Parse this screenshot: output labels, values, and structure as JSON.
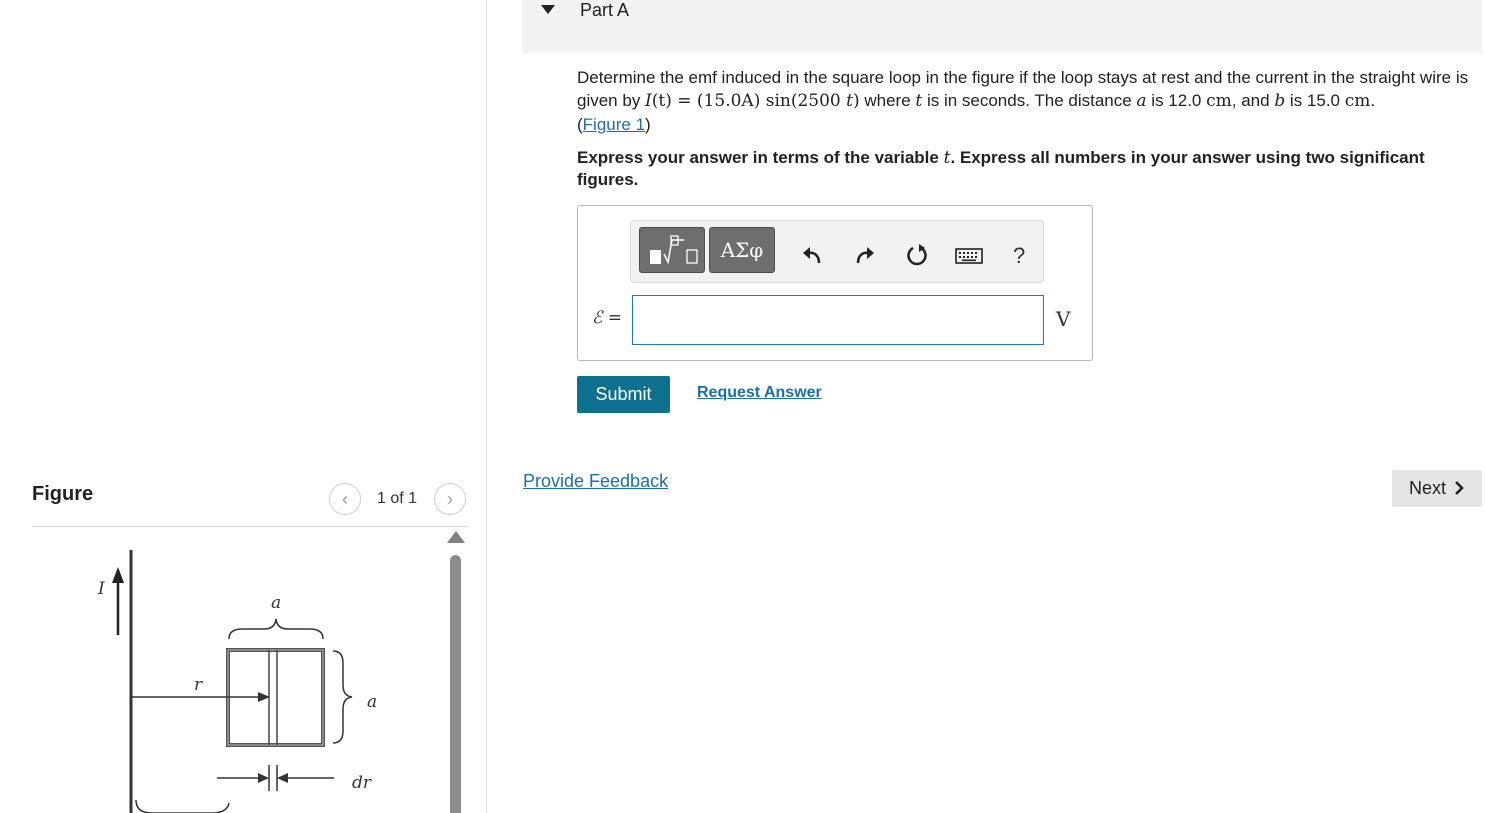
{
  "part": {
    "title": "Part A",
    "question": {
      "intro": "Determine the emf induced in the square loop in the figure if the loop stays at rest and the current in the straight wire is given by ",
      "formula_I": "I",
      "formula_t1": "(t)",
      "formula_eq": " = (15.0A) sin(2500 ",
      "formula_t2": "t",
      "formula_close": ")",
      "mid1": " where ",
      "var_t": "t",
      "mid2": " is in seconds. The distance ",
      "var_a": "a",
      "mid3": " is 12.0 ",
      "unit1": "cm",
      "mid4": ", and ",
      "var_b": "b",
      "mid5": " is 15.0 ",
      "unit2": "cm",
      "end": ".",
      "figure_link_open": "(",
      "figure_link": "Figure 1",
      "figure_link_close": ")"
    },
    "instructions": {
      "pre": "Express your answer in terms of the variable ",
      "var": "t",
      "post": ". Express all numbers in your answer using two significant figures."
    }
  },
  "toolbar": {
    "greek_label": "ΑΣφ",
    "help_label": "?",
    "icons": [
      "templates-icon",
      "undo-icon",
      "redo-icon",
      "reset-icon",
      "keyboard-icon",
      "help-icon"
    ]
  },
  "answer": {
    "label": "ℰ =",
    "value": "",
    "unit": "V"
  },
  "actions": {
    "submit_label": "Submit",
    "request_answer_label": "Request Answer",
    "provide_feedback_label": "Provide Feedback",
    "next_label": "Next"
  },
  "figure_panel": {
    "title": "Figure",
    "pager": "1 of 1",
    "labels": {
      "current": "I",
      "a_top": "a",
      "a_side": "a",
      "r": "r",
      "dr": "dr"
    }
  },
  "colors": {
    "accent": "#0f6f8e",
    "link": "#1d6fa5",
    "header_bg": "#f3f3f3"
  }
}
